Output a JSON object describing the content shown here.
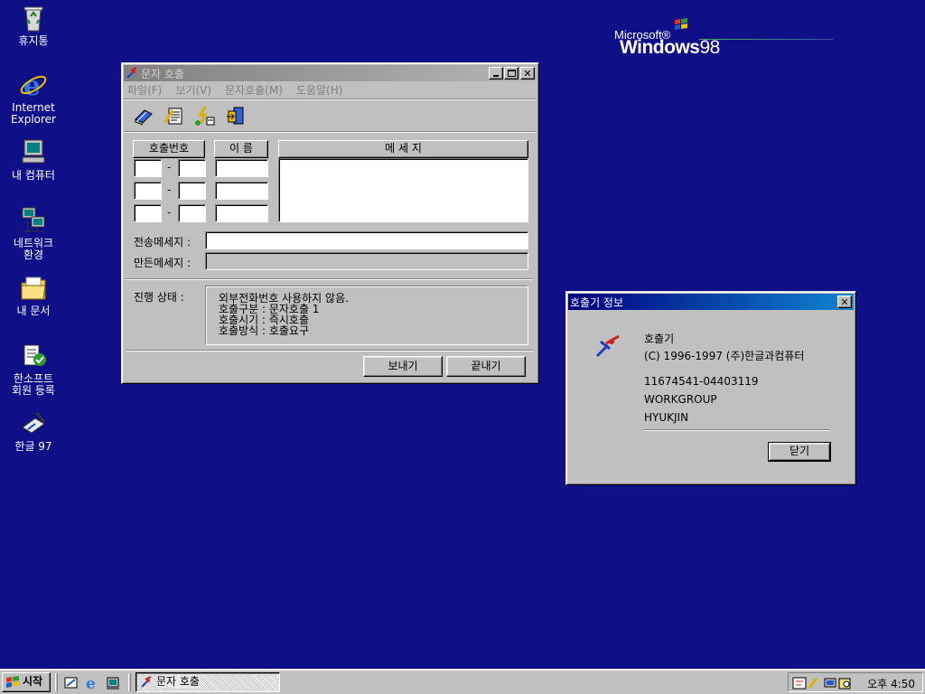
{
  "desktop": {
    "icons": [
      {
        "label_lines": [
          "휴지통"
        ],
        "icon": "recycle-bin-icon"
      },
      {
        "label_lines": [
          "Internet",
          "Explorer"
        ],
        "icon": "internet-explorer-icon"
      },
      {
        "label_lines": [
          "내 컴퓨터"
        ],
        "icon": "my-computer-icon"
      },
      {
        "label_lines": [
          "네트워크",
          "환경"
        ],
        "icon": "network-icon"
      },
      {
        "label_lines": [
          "내 문서"
        ],
        "icon": "my-documents-icon"
      },
      {
        "label_lines": [
          "한소프트",
          "회원 등록"
        ],
        "icon": "registration-icon"
      },
      {
        "label_lines": [
          "한글 97"
        ],
        "icon": "hangul-icon"
      }
    ],
    "logo": {
      "microsoft": "Microsoft®",
      "windows": "Windows",
      "version": "98"
    }
  },
  "pager_window": {
    "title": "문자 호출",
    "menu": [
      "파일(F)",
      "보기(V)",
      "문자호출(M)",
      "도움말(H)"
    ],
    "toolbar": [
      "phonebook-icon",
      "memo-icon",
      "send-page-icon",
      "exit-icon"
    ],
    "headers": {
      "number": "호출번호",
      "name": "이 름",
      "message": "메 세 지"
    },
    "send_message_label": "전송메세지 :",
    "made_message_label": "만든메세지 :",
    "send_message_value": "",
    "status_label": "진행  상태 :",
    "status_lines": [
      "외부전화번호 사용하지 않음.",
      "호출구분 : 문자호출 1",
      "호출시기 : 즉시호출",
      "호출방식 : 호출요구"
    ],
    "send_button": "보내기",
    "exit_button": "끝내기"
  },
  "about_dialog": {
    "title": "호출기 정보",
    "app_name": "호출기",
    "copyright": "(C) 1996-1997 (주)한글과컴퓨터",
    "serial": "11674541-04403119",
    "workgroup": "WORKGROUP",
    "user": "HYUKJIN",
    "close_button": "닫기"
  },
  "taskbar": {
    "start": "시작",
    "task": "문자 호출",
    "clock": "오후 4:50"
  },
  "colors": {
    "desktop": "#0f0f87",
    "face": "#c0c0c0",
    "active_title": "#000080"
  }
}
